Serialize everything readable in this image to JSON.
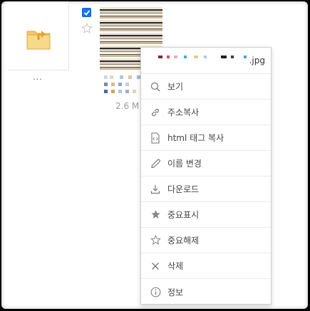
{
  "parent_folder": {
    "label": "..."
  },
  "file": {
    "checked": true,
    "size_label": "2.6 M",
    "extension_label": ".jpg"
  },
  "context_menu": {
    "items": [
      {
        "label": "보기",
        "icon": "search-icon"
      },
      {
        "label": "주소복사",
        "icon": "link-icon"
      },
      {
        "label": "html 태그 복사",
        "icon": "code-file-icon"
      },
      {
        "label": "이름 변경",
        "icon": "pencil-icon"
      },
      {
        "label": "다운로드",
        "icon": "download-icon"
      },
      {
        "label": "중요표시",
        "icon": "star-filled-icon"
      },
      {
        "label": "중요해제",
        "icon": "star-outline-icon"
      },
      {
        "label": "삭제",
        "icon": "close-icon"
      },
      {
        "label": "정보",
        "icon": "info-icon"
      }
    ]
  },
  "colors": {
    "accent": "#1a73e8",
    "folder": "#f2c96b",
    "folder_arrow": "#f0a020"
  }
}
